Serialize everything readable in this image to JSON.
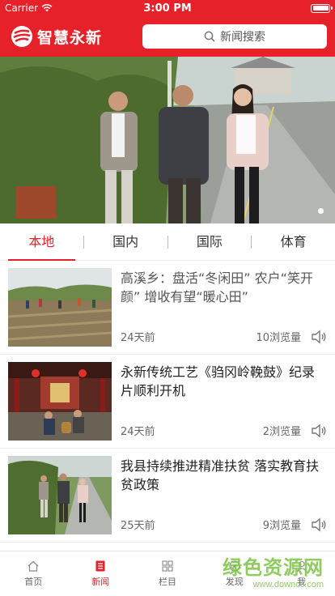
{
  "status": {
    "carrier": "Carrier",
    "time": "3:00 PM"
  },
  "app": {
    "title": "智慧永新"
  },
  "search": {
    "placeholder": "新闻搜索"
  },
  "tabs": [
    {
      "label": "本地",
      "active": true
    },
    {
      "label": "国内",
      "active": false
    },
    {
      "label": "国际",
      "active": false
    },
    {
      "label": "体育",
      "active": false
    }
  ],
  "articles": [
    {
      "title": "高溪乡：盘活“冬闲田” 农户“笑开颜” 增收有望“暖心田”",
      "time": "24天前",
      "views": "10浏览量",
      "thumb": "field"
    },
    {
      "title": "永新传统工艺《驺冈岭鞔鼓》纪录片顺利开机",
      "time": "24天前",
      "views": "2浏览量",
      "thumb": "temple"
    },
    {
      "title": "我县持续推进精准扶贫 落实教育扶贫政策",
      "time": "25天前",
      "views": "9浏览量",
      "thumb": "road"
    }
  ],
  "tabbar": [
    {
      "label": "首页",
      "icon": "home-icon",
      "active": false
    },
    {
      "label": "新闻",
      "icon": "news-icon",
      "active": true
    },
    {
      "label": "栏目",
      "icon": "grid-icon",
      "active": false
    },
    {
      "label": "发现",
      "icon": "discover-icon",
      "active": false
    },
    {
      "label": "我",
      "icon": "user-icon",
      "active": false
    }
  ],
  "watermark": {
    "main": "绿色资源网",
    "url": "www.downcc.com"
  },
  "colors": {
    "brand": "#e62129",
    "watermark": "#7cc242"
  }
}
